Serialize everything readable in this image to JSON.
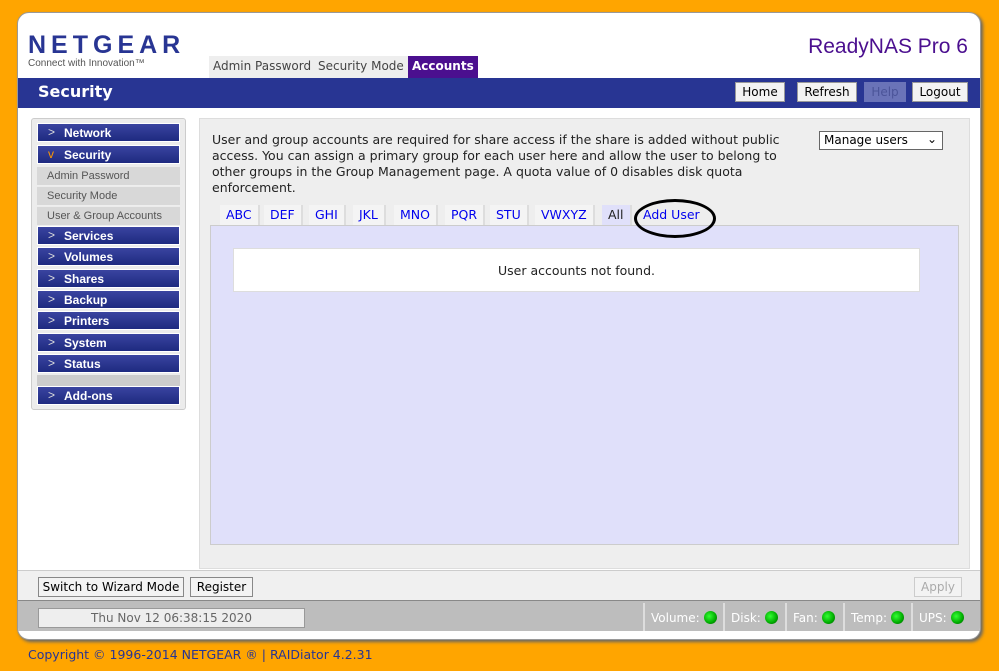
{
  "brand": {
    "logo": "NETGEAR",
    "tagline": "Connect with Innovation™",
    "product": "ReadyNAS Pro 6"
  },
  "top_tabs": [
    {
      "label": "Admin Password"
    },
    {
      "label": "Security Mode"
    },
    {
      "label": "Accounts",
      "active": true
    }
  ],
  "header": {
    "title": "Security",
    "buttons": {
      "home": "Home",
      "refresh": "Refresh",
      "help": "Help",
      "logout": "Logout"
    }
  },
  "sidebar": {
    "items": [
      {
        "label": "Network"
      },
      {
        "label": "Security",
        "expanded": true
      },
      {
        "label": "Services"
      },
      {
        "label": "Volumes"
      },
      {
        "label": "Shares"
      },
      {
        "label": "Backup"
      },
      {
        "label": "Printers"
      },
      {
        "label": "System"
      },
      {
        "label": "Status"
      },
      {
        "label": "Add-ons"
      }
    ],
    "subitems": [
      {
        "label": "Admin Password"
      },
      {
        "label": "Security Mode"
      },
      {
        "label": "User & Group Accounts"
      }
    ]
  },
  "main": {
    "description": "User and group accounts are required for share access if the share is added without public access. You can assign a primary group for each user here and allow the user to belong to other groups in the Group Management page. A quota value of 0 disables disk quota enforcement.",
    "select_value": "Manage users",
    "letter_tabs": [
      "ABC",
      "DEF",
      "GHI",
      "JKL",
      "MNO",
      "PQR",
      "STU",
      "VWXYZ",
      "All",
      "Add User"
    ],
    "empty_message": "User accounts not found."
  },
  "bottom": {
    "wizard": "Switch to Wizard Mode",
    "register": "Register",
    "apply": "Apply"
  },
  "status": {
    "datetime": "Thu Nov 12  06:38:15 2020",
    "indicators": [
      {
        "label": "Volume:"
      },
      {
        "label": "Disk:"
      },
      {
        "label": "Fan:"
      },
      {
        "label": "Temp:"
      },
      {
        "label": "UPS:"
      }
    ],
    "led_color": "#00cc00"
  },
  "footer": "Copyright © 1996-2014 NETGEAR ® | RAIDiator 4.2.31"
}
